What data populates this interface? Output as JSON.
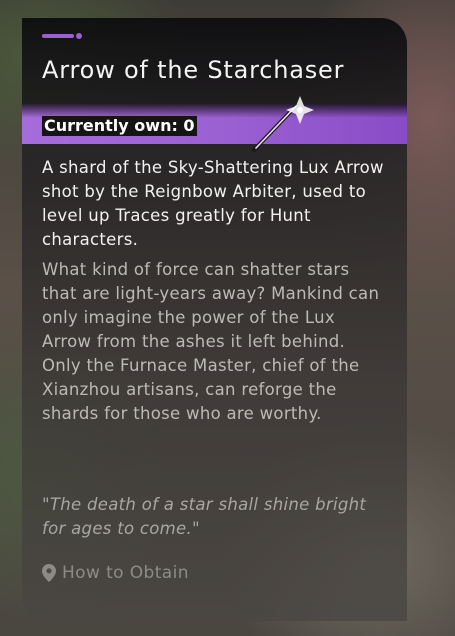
{
  "item": {
    "title": "Arrow of the Starchaser",
    "owned_label": "Currently own: 0",
    "description": "A shard of the Sky-Shattering Lux Arrow shot by the Reignbow Arbiter, used to level up Traces greatly for Hunt characters.",
    "lore_paragraph_1": "What kind of force can shatter stars that are light-years away? Mankind can only imagine the power of the Lux Arrow from the ashes it left behind.",
    "lore_paragraph_2": "Only the Furnace Master, chief of the Xianzhou artisans, can reforge the shards for those who are worthy.",
    "quote": "\"The death of a star shall shine bright for ages to come.\""
  },
  "actions": {
    "how_to_obtain_label": "How to Obtain",
    "how_to_obtain_icon": "location-pin-icon"
  },
  "colors": {
    "accent": "#9b5fd0",
    "owned_bar": "#9a5fd2",
    "title_text": "#f4f4f4",
    "lore_text": "#bdbab6"
  }
}
